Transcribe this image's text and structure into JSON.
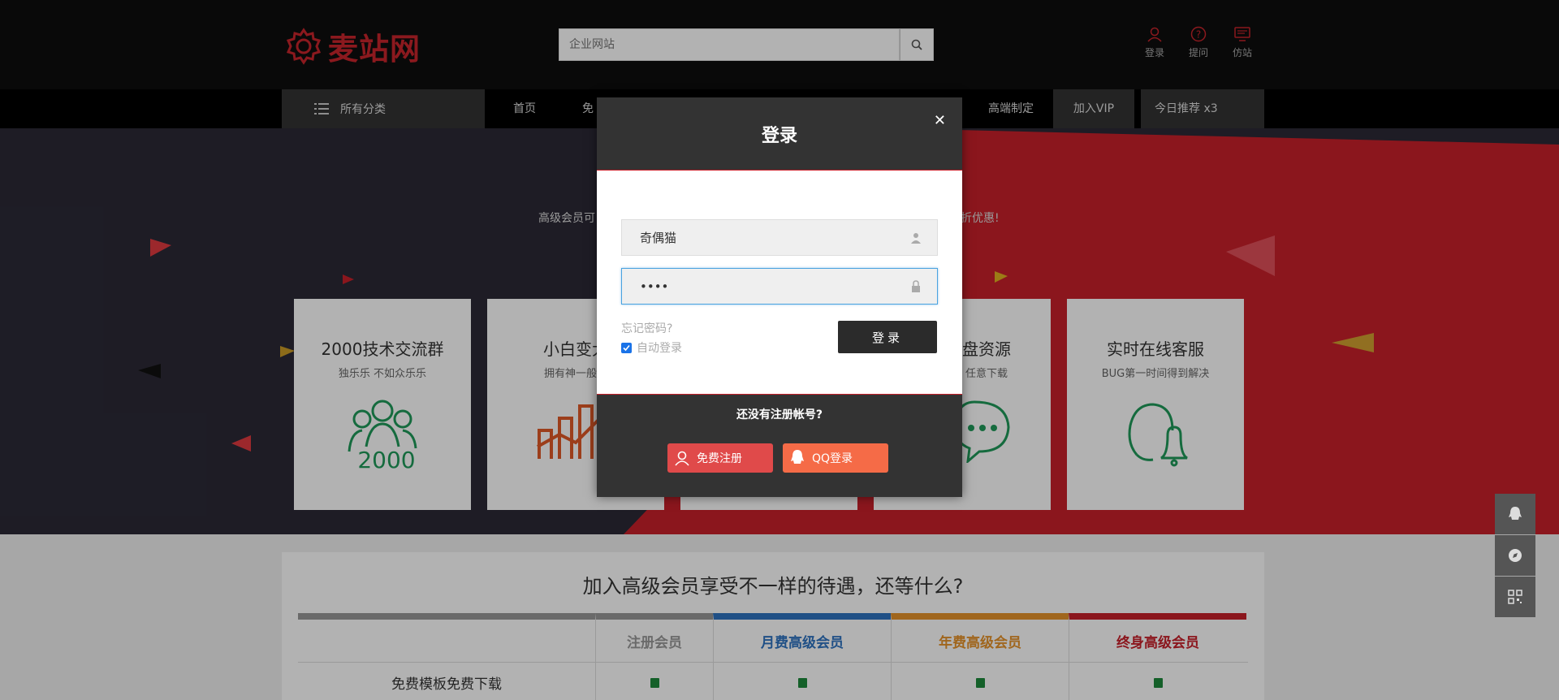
{
  "header": {
    "logo_text": "麦站网",
    "search_placeholder": "企业网站",
    "actions": [
      {
        "label": "登录",
        "icon": "user-icon"
      },
      {
        "label": "提问",
        "icon": "question-icon"
      },
      {
        "label": "仿站",
        "icon": "monitor-icon"
      }
    ]
  },
  "nav": {
    "categories_label": "所有分类",
    "items": [
      "首页",
      "免",
      "高端制定"
    ],
    "vip_label": "加入VIP",
    "today_label": "今日推荐 x3"
  },
  "banner": {
    "text_left": "高级会员可",
    "text_right": "折优惠!",
    "cards": [
      {
        "title": "2000技术交流群",
        "sub": "独乐乐 不如众乐乐",
        "icon": "group-2000-icon"
      },
      {
        "title": "小白变大",
        "sub": "拥有神一般的",
        "icon": "chart-growth-icon"
      },
      {
        "title": "",
        "sub": "",
        "icon": ""
      },
      {
        "title": "盘资源",
        "sub": "任意下载",
        "icon": "chat-bubble-icon"
      },
      {
        "title": "实时在线客服",
        "sub": "BUG第一时间得到解决",
        "icon": "support-agent-icon"
      }
    ]
  },
  "modal": {
    "title": "登录",
    "username_value": "奇偶猫",
    "password_value": "••••",
    "forgot_label": "忘记密码?",
    "auto_login_label": "自动登录",
    "login_button": "登录",
    "no_account": "还没有注册帐号?",
    "register_button": "免费注册",
    "qq_button": "QQ登录"
  },
  "member": {
    "title": "加入高级会员享受不一样的待遇，还等什么?",
    "columns": [
      {
        "label": "",
        "color": "#999999"
      },
      {
        "label": "注册会员",
        "color": "#999999"
      },
      {
        "label": "月费高级会员",
        "color": "#2f73c0"
      },
      {
        "label": "年费高级会员",
        "color": "#e6922a"
      },
      {
        "label": "终身高级会员",
        "color": "#c8202a"
      }
    ],
    "row_label": "免费模板免费下载"
  },
  "colors": {
    "brand_red": "#c7242b",
    "dark": "#0d0d0d",
    "banner_dark": "#2b2936",
    "banner_red": "#c8202a"
  }
}
